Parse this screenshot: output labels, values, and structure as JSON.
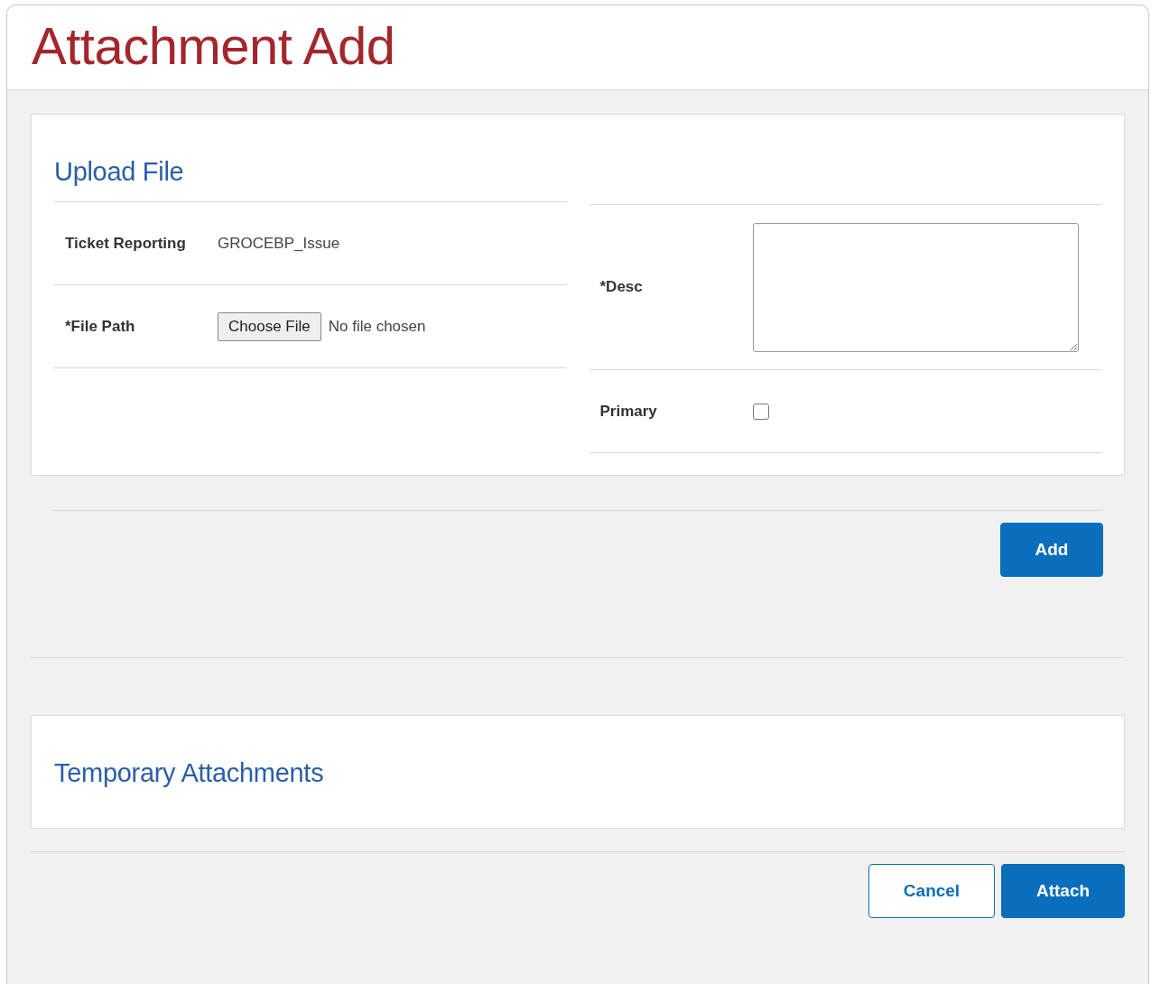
{
  "window": {
    "title": "Attachment Add"
  },
  "upload_panel": {
    "heading": "Upload File",
    "left_rows": [
      {
        "kind": "text",
        "label": "Ticket Reporting",
        "value": "GROCEBP_Issue"
      },
      {
        "kind": "file",
        "label": "*File Path",
        "button": "Choose File",
        "value": "No file chosen"
      }
    ],
    "right_rows": [
      {
        "kind": "textarea",
        "label": "*Desc"
      },
      {
        "kind": "checkbox",
        "label": "Primary",
        "checked": false
      }
    ]
  },
  "add_button": "Add",
  "temp_panel": {
    "heading": "Temporary Attachments"
  },
  "footer_buttons": [
    {
      "kind": "secondary",
      "label": "Cancel"
    },
    {
      "kind": "primary",
      "label": "Attach"
    }
  ]
}
